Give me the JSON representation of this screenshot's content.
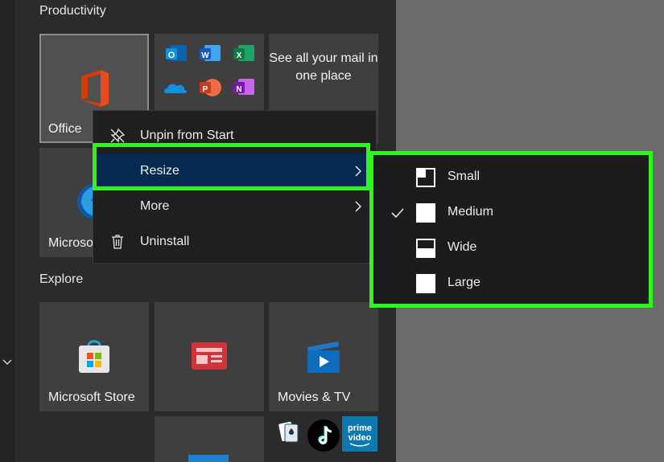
{
  "groups": {
    "productivity": "Productivity",
    "explore": "Explore"
  },
  "tiles": {
    "office": "Office",
    "mail": "See all your mail in one place",
    "edge": "Microso",
    "store": "Microsoft Store",
    "movies": "Movies & TV"
  },
  "context_menu": {
    "unpin": "Unpin from Start",
    "resize": "Resize",
    "more": "More",
    "uninstall": "Uninstall"
  },
  "resize_menu": {
    "selected": "Medium",
    "items": [
      "Small",
      "Medium",
      "Wide",
      "Large"
    ]
  },
  "icons": {
    "rail": "chevron-down-icon",
    "office": "office-logo-icon",
    "apps": [
      "outlook-icon",
      "word-icon",
      "excel-icon",
      "onedrive-icon",
      "powerpoint-icon",
      "onenote-icon"
    ],
    "edge": "edge-logo-icon",
    "store": "store-bag-icon",
    "news": "news-icon",
    "movies": "movies-tv-icon",
    "bottom_apps": [
      "solitaire-icon",
      "tiktok-icon",
      "prime-video-icon"
    ],
    "menu": [
      "unpin-icon",
      "trash-icon",
      "chevron-right-icon"
    ]
  },
  "colors": {
    "highlight": "#2ef51f",
    "menu_selected": "#062a4f",
    "panel": "#2b2b2b",
    "desktop": "#6b6b6b",
    "office_red": "#d83b01"
  }
}
